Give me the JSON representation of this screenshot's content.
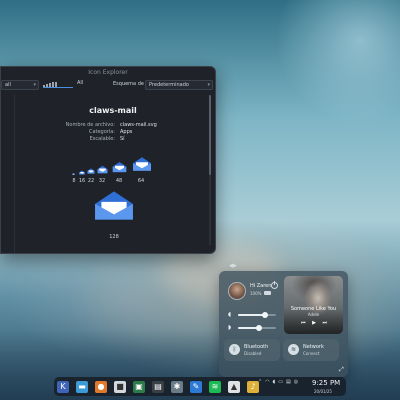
{
  "window": {
    "title": "Icon Explorer",
    "filter_value": "all",
    "size_value": "All",
    "scheme_label": "Esquema de color:",
    "scheme_value": "Predeterminado"
  },
  "icon": {
    "name": "claws-mail",
    "keys": [
      "Nombre de archivo:",
      "Categoría:",
      "Escalable:"
    ],
    "values": [
      "claws-mail.svg",
      "Apps",
      "Sí"
    ],
    "sizes": [
      "8",
      "16",
      "22",
      "32",
      "48",
      "64",
      "128"
    ],
    "envelope_color": "#2f6fd6",
    "envelope_flap_color": "#5c97ee"
  },
  "control_center": {
    "user_greeting": "Hi Zaren",
    "battery_text": "100%",
    "volume_level": 0.72,
    "mic_level": 0.55,
    "media": {
      "song": "Someone Like You",
      "artist": "Adele"
    },
    "bluetooth": {
      "title": "Bluetooth",
      "status": "Disabled"
    },
    "network": {
      "title": "Network",
      "status": "Connect"
    }
  },
  "taskbar": {
    "apps": [
      {
        "icon": "kde-logo-icon",
        "color": "#3e63b8",
        "glyph": "K"
      },
      {
        "icon": "folder-icon",
        "color": "#3c9bd6",
        "glyph": "▬"
      },
      {
        "icon": "firefox-icon",
        "color": "#e07a2b",
        "glyph": "●"
      },
      {
        "icon": "store-icon",
        "color": "#d3d8dc",
        "glyph": "■"
      },
      {
        "icon": "monitor-icon",
        "color": "#2d7a4a",
        "glyph": "▣"
      },
      {
        "icon": "terminal-icon",
        "color": "#3a3f45",
        "glyph": "▤"
      },
      {
        "icon": "settings-icon",
        "color": "#6b7c88",
        "glyph": "✱"
      },
      {
        "icon": "code-icon",
        "color": "#2d7ad6",
        "glyph": "✎"
      },
      {
        "icon": "spotify-icon",
        "color": "#1db954",
        "glyph": "≋"
      },
      {
        "icon": "inkscape-icon",
        "color": "#dfe3e6",
        "glyph": "▲"
      },
      {
        "icon": "music-icon",
        "color": "#e0b13a",
        "glyph": "♪"
      }
    ],
    "time": "9:25 PM",
    "date": "20/01/25"
  },
  "colors": {
    "window_bg": "#1f2229",
    "accent": "#4a8fe0",
    "taskbar_bg": "#18202a"
  }
}
